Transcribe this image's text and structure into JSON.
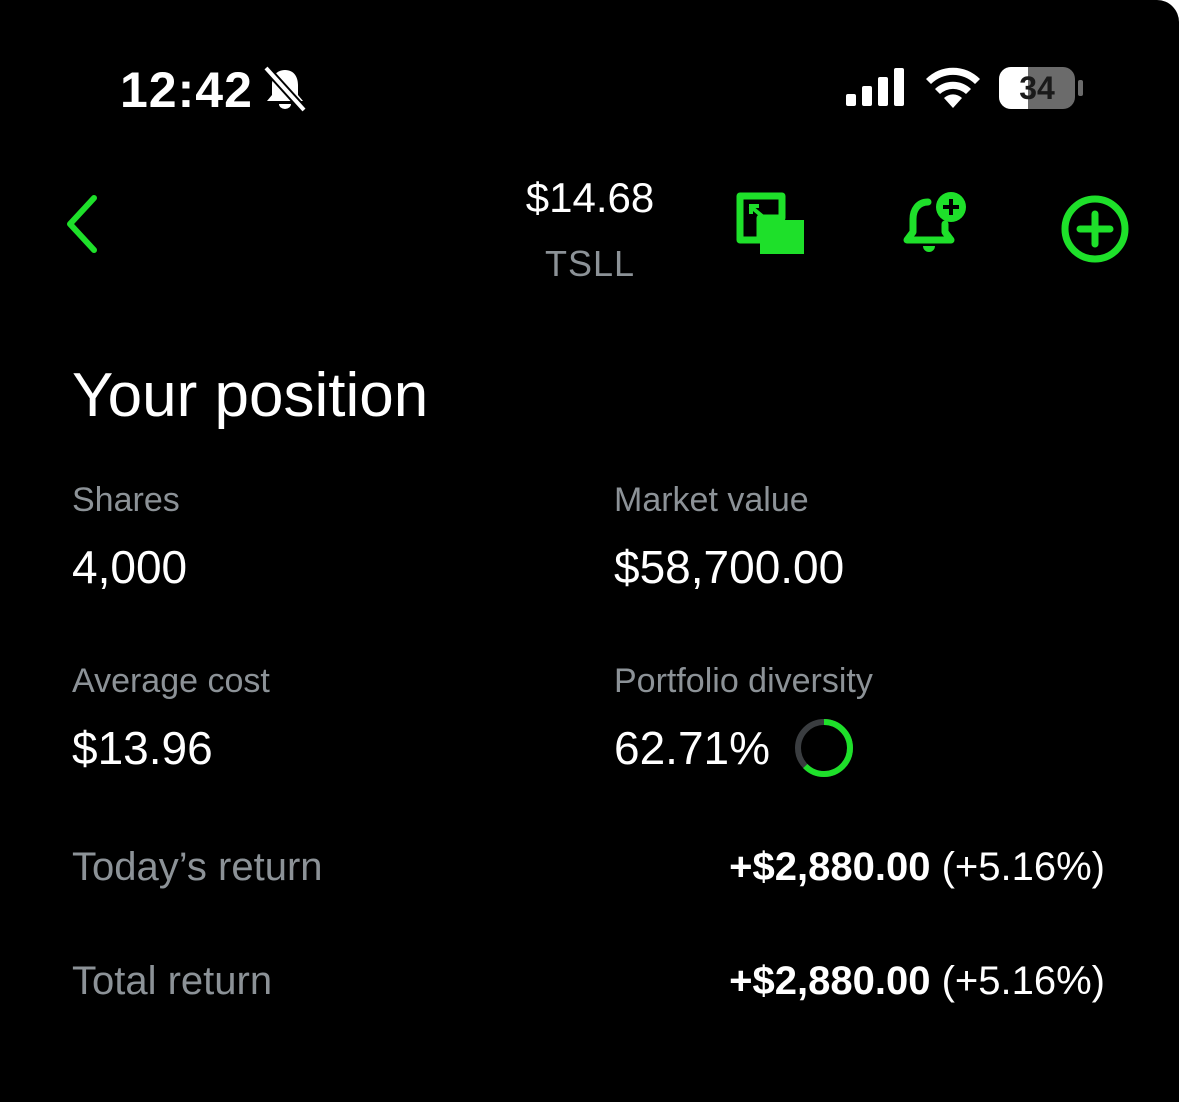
{
  "status_bar": {
    "time": "12:42",
    "silent_icon": "bell-slash-icon",
    "signal_icon": "cellular-signal-icon",
    "wifi_icon": "wifi-icon",
    "battery_level": "34"
  },
  "header": {
    "back_icon": "chevron-left-icon",
    "price": "$14.68",
    "ticker": "TSLL",
    "actions": [
      "picture-in-picture-icon",
      "bell-plus-icon",
      "plus-circle-icon"
    ]
  },
  "position": {
    "title": "Your position",
    "shares_label": "Shares",
    "shares_value": "4,000",
    "market_value_label": "Market value",
    "market_value": "$58,700.00",
    "avg_cost_label": "Average cost",
    "avg_cost_value": "$13.96",
    "diversity_label": "Portfolio diversity",
    "diversity_value": "62.71%",
    "diversity_fraction": 0.6271,
    "todays_return_label": "Today’s return",
    "todays_return_amount": "+$2,880.00",
    "todays_return_pct": "(+5.16%)",
    "total_return_label": "Total return",
    "total_return_amount": "+$2,880.00",
    "total_return_pct": "(+5.16%)"
  },
  "colors": {
    "accent_green": "#1ee02a",
    "background": "#000000",
    "text_primary": "#ffffff",
    "text_secondary": "#8c9297"
  }
}
